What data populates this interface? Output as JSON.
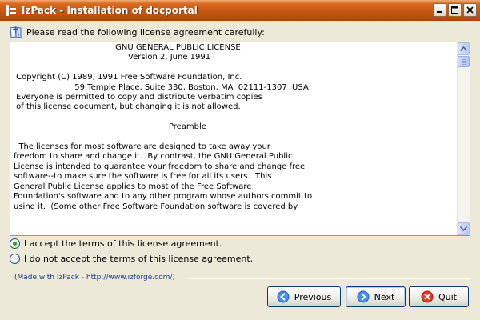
{
  "window": {
    "title": "IzPack - Installation of  docportal"
  },
  "prompt": "Please read the following license agreement carefully:",
  "license": {
    "lines": [
      "                                        GNU GENERAL PUBLIC LICENSE",
      "                                             Version 2, June 1991",
      "",
      " Copyright (C) 1989, 1991 Free Software Foundation, Inc.",
      "                        59 Temple Place, Suite 330, Boston, MA  02111-1307  USA",
      " Everyone is permitted to copy and distribute verbatim copies",
      " of this license document, but changing it is not allowed.",
      "",
      "                                                             Preamble",
      "",
      "  The licenses for most software are designed to take away your",
      "freedom to share and change it.  By contrast, the GNU General Public",
      "License is intended to guarantee your freedom to share and change free",
      "software--to make sure the software is free for all its users.  This",
      "General Public License applies to most of the Free Software",
      "Foundation's software and to any other program whose authors commit to",
      "using it.  (Some other Free Software Foundation software is covered by"
    ]
  },
  "options": {
    "accept": "I accept the terms of this license agreement.",
    "decline": "I do not accept the terms of this license agreement.",
    "selected": "accept"
  },
  "footer": {
    "made_with": "(Made with IzPack - http://www.izforge.com/)"
  },
  "buttons": {
    "previous": "Previous",
    "next": "Next",
    "quit": "Quit"
  },
  "colors": {
    "titlebar": "#c75a14",
    "link_text": "#1d3d8a",
    "radio_check": "#21a121"
  }
}
